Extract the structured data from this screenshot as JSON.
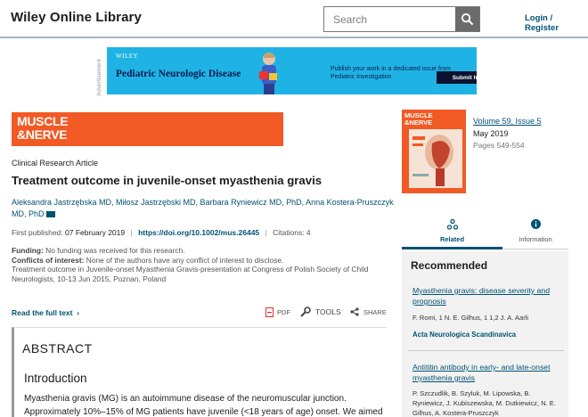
{
  "header": {
    "brand": "Wiley Online Library",
    "search_placeholder": "Search",
    "login": "Login / Register"
  },
  "ad": {
    "label": "Advertisement",
    "brand": "WILEY",
    "title": "Pediatric Neurologic Disease",
    "text": "Publish your work in a dedicated issue from Pediatric Investigation",
    "button": "Submit here"
  },
  "journal": {
    "banner": "MUSCLE\n&NERVE",
    "cover_title": "MUSCLE\n&NERVE",
    "volume": "Volume 59, Issue 5",
    "date": "May 2019",
    "pages": "Pages 549-554"
  },
  "article": {
    "type": "Clinical Research Article",
    "title": "Treatment outcome in juvenile-onset myasthenia gravis",
    "authors": "Aleksandra Jastrzębska MD, Miłosz Jastrzębski MD, Barbara Ryniewicz MD, PhD, Anna Kostera-Pruszczyk MD, PhD",
    "first_published_label": "First published:",
    "first_published": "07 February 2019",
    "doi": "https://doi.org/10.1002/mus.26445",
    "citations": "Citations: 4",
    "funding_label": "Funding:",
    "funding": "No funding was received for this research.",
    "conflicts_label": "Conflicts of interest:",
    "conflicts": "None of the authors have any conflict of interest to disclose.",
    "presentation": "Treatment outcome in Juvenile-onset Myasthenia Gravis-presentation at Congress of Polish Society of Child Neurologists, 10-13 Jun 2015, Poznan, Poland"
  },
  "actions": {
    "read_full": "Read the full text",
    "pdf": "PDF",
    "tools": "TOOLS",
    "share": "SHARE"
  },
  "abstract": {
    "heading": "ABSTRACT",
    "intro_heading": "Introduction",
    "text": "Myasthenia gravis (MG) is an autoimmune disease of the neuromuscular junction. Approximately 10%–15% of MG patients have juvenile (<18 years of age) onset. We aimed"
  },
  "tabs": {
    "related": "Related",
    "information": "Information"
  },
  "recommended": {
    "heading": "Recommended",
    "items": [
      {
        "title": "Myasthenia gravis: disease severity and prognosis",
        "authors": "F. Romi, 1 N. E. Gilhus, 1 1,2 J. A. Aarli",
        "journal": "Acta Neurologica Scandinavica"
      },
      {
        "title": "Antititin antibody in early- and late-onset myasthenia gravis",
        "authors": "P. Szczudlik, B. Szyluk, M. Lipowska, B. Ryniewicz, J. Kubiszewska, M. Dutkiewicz, N. E. Gilhus, A. Kostera-Pruszczyk"
      }
    ]
  },
  "colors": {
    "link": "#005274",
    "journal_orange": "#f15a24",
    "ad_blue": "#1fb3e5"
  }
}
